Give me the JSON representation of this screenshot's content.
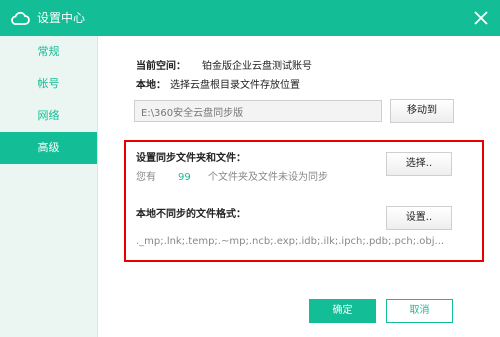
{
  "window": {
    "title": "设置中心",
    "close_icon": "close-icon",
    "logo_icon": "cloud-icon"
  },
  "colors": {
    "accent": "#13bd95",
    "highlight": "#e60000"
  },
  "sidebar": {
    "items": [
      {
        "label": "常规",
        "active": false
      },
      {
        "label": "帐号",
        "active": false
      },
      {
        "label": "网络",
        "active": false
      },
      {
        "label": "高级",
        "active": true
      }
    ]
  },
  "advanced": {
    "current_space_label": "当前空间：",
    "current_space_value": "铂金版企业云盘测试账号",
    "local_label": "本地：",
    "local_desc": "选择云盘根目录文件存放位置",
    "path_value": "E:\\360安全云盘同步版",
    "move_button": "移动到",
    "sync_folders_title": "设置同步文件夹和文件：",
    "sync_status_prefix": "您有",
    "sync_status_count": "99",
    "sync_status_suffix": "个文件夹及文件未设为同步",
    "select_button": "选择..",
    "nosync_title": "本地不同步的文件格式：",
    "settings_button": "设置..",
    "nosync_formats": "._mp;.lnk;.temp;.~mp;.ncb;.exp;.idb;.ilk;.ipch;.pdb;.pch;.obj..."
  },
  "footer": {
    "ok_label": "确定",
    "cancel_label": "取消"
  }
}
